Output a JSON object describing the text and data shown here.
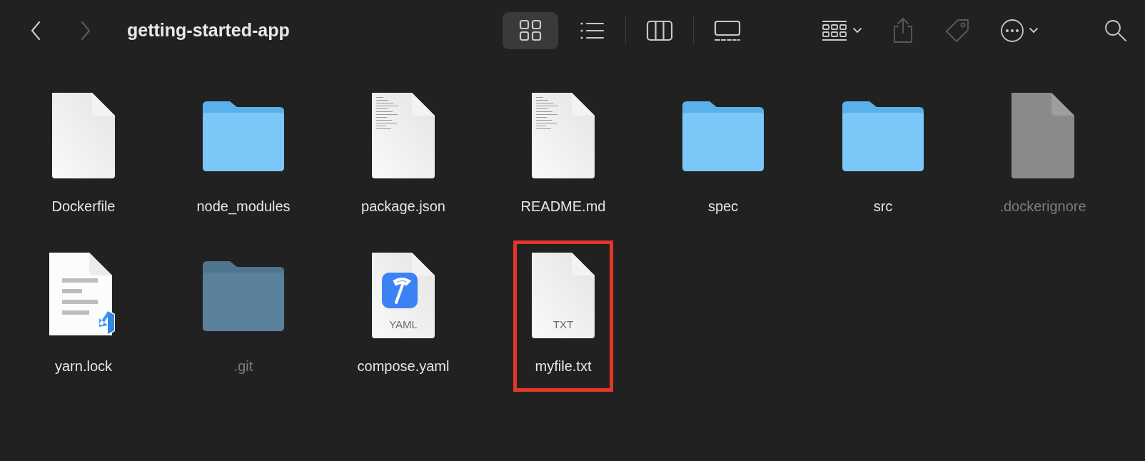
{
  "window": {
    "title": "getting-started-app"
  },
  "navigation": [
    {
      "kind": "back",
      "disabled": false
    },
    {
      "kind": "forward",
      "disabled": true
    }
  ],
  "view_modes": [
    {
      "kind": "icons",
      "selected": true
    },
    {
      "kind": "list",
      "selected": false
    },
    {
      "kind": "columns",
      "selected": false
    },
    {
      "kind": "gallery",
      "selected": false
    }
  ],
  "toolbar": [
    {
      "kind": "group"
    },
    {
      "kind": "share",
      "disabled": true
    },
    {
      "kind": "tag",
      "disabled": true
    },
    {
      "kind": "more",
      "disabled": false
    },
    {
      "kind": "search",
      "disabled": false
    }
  ],
  "files": [
    {
      "name": "Dockerfile",
      "kind": "document",
      "hidden": false,
      "marked": false
    },
    {
      "name": "node_modules",
      "kind": "folder",
      "hidden": false,
      "marked": false
    },
    {
      "name": "package.json",
      "kind": "text-document",
      "hidden": false,
      "marked": false
    },
    {
      "name": "README.md",
      "kind": "text-document",
      "hidden": false,
      "marked": false
    },
    {
      "name": "spec",
      "kind": "folder",
      "hidden": false,
      "marked": false
    },
    {
      "name": "src",
      "kind": "folder",
      "hidden": false,
      "marked": false
    },
    {
      "name": ".dockerignore",
      "kind": "document",
      "hidden": true,
      "marked": false
    },
    {
      "name": "yarn.lock",
      "kind": "editor-document",
      "hidden": false,
      "marked": false
    },
    {
      "name": ".git",
      "kind": "folder",
      "hidden": true,
      "marked": false
    },
    {
      "name": "compose.yaml",
      "kind": "yaml",
      "badge": "YAML",
      "hidden": false,
      "marked": false
    },
    {
      "name": "myfile.txt",
      "kind": "typed-document",
      "badge": "TXT",
      "hidden": false,
      "marked": true
    }
  ]
}
